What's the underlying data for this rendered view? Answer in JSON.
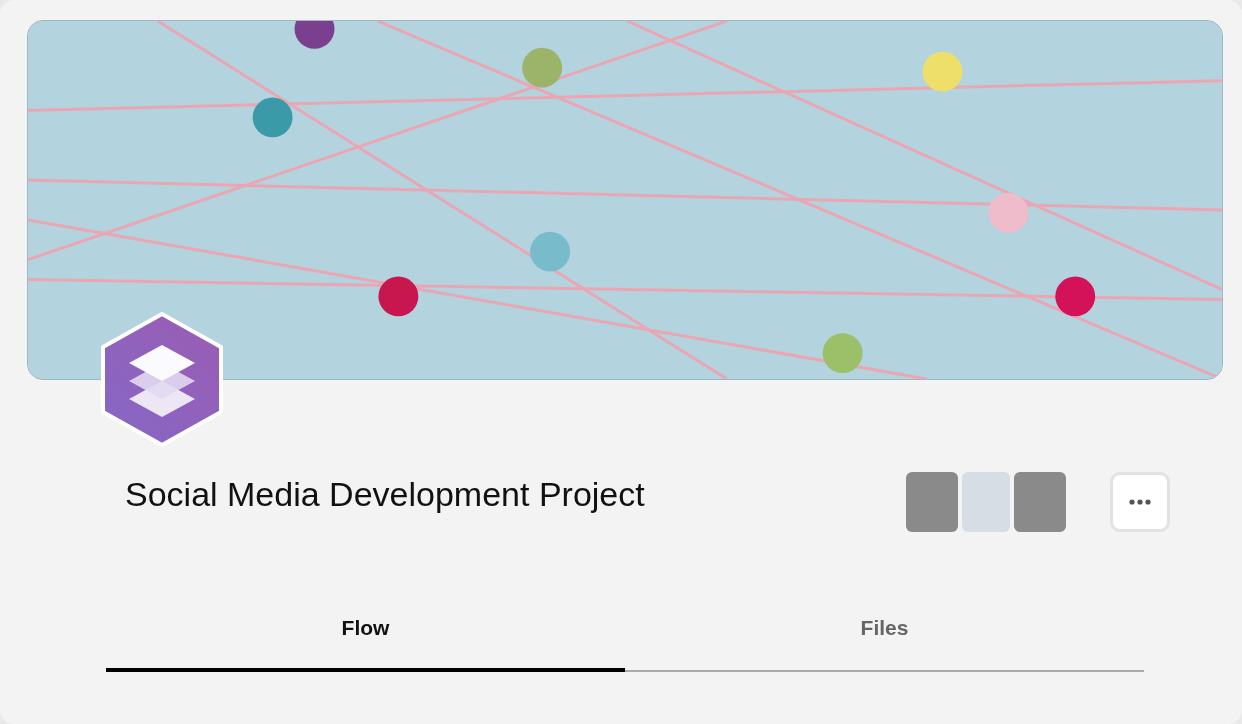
{
  "project": {
    "title": "Social Media Development Project"
  },
  "members": [
    {
      "kind": "photo"
    },
    {
      "kind": "photo"
    },
    {
      "kind": "photo"
    }
  ],
  "tabs": [
    {
      "label": "Flow",
      "selected": true
    },
    {
      "label": "Files",
      "selected": false
    }
  ]
}
